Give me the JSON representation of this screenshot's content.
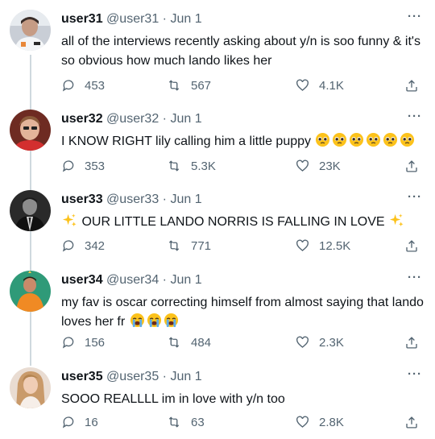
{
  "tweets": [
    {
      "username": "user31",
      "handle": "@user31",
      "sep": "·",
      "date": "Jun 1",
      "text": "all of the interviews recently asking about y/n is soo funny & it's so obvious how much lando likes her",
      "replies": "453",
      "retweets": "567",
      "likes": "4.1K"
    },
    {
      "username": "user32",
      "handle": "@user32",
      "sep": "·",
      "date": "Jun 1",
      "text": "I KNOW RIGHT lily calling him a little puppy",
      "emojis": [
        "pleading-face",
        "pleading-face",
        "pleading-face",
        "pleading-face",
        "pleading-face",
        "pleading-face"
      ],
      "replies": "353",
      "retweets": "5.3K",
      "likes": "23K"
    },
    {
      "username": "user33",
      "handle": "@user33",
      "sep": "·",
      "date": "Jun 1",
      "text": "OUR LITTLE LANDO NORRIS IS FALLING IN LOVE",
      "emojis": [
        "sparkles",
        "sparkles"
      ],
      "replies": "342",
      "retweets": "771",
      "likes": "12.5K"
    },
    {
      "username": "user34",
      "handle": "@user34",
      "sep": "·",
      "date": "Jun 1",
      "text": "my fav is oscar correcting himself from almost saying that lando loves her fr",
      "emojis": [
        "loudly-crying-face",
        "loudly-crying-face",
        "loudly-crying-face"
      ],
      "replies": "156",
      "retweets": "484",
      "likes": "2.3K"
    },
    {
      "username": "user35",
      "handle": "@user35",
      "sep": "·",
      "date": "Jun 1",
      "text": "SOOO REALLLL im in love with y/n too",
      "replies": "16",
      "retweets": "63",
      "likes": "2.8K"
    }
  ],
  "colors": {
    "text": "#0f1419",
    "muted": "#536471",
    "thread": "#cfd9de"
  },
  "icons": {
    "reply": "reply-icon",
    "retweet": "retweet-icon",
    "like": "heart-icon",
    "share": "share-icon",
    "more": "more-icon"
  }
}
